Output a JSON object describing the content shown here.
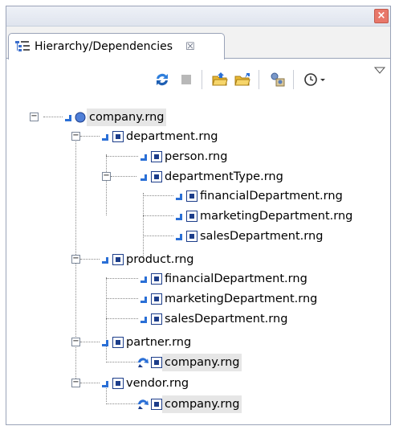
{
  "window": {
    "close_glyph": "×"
  },
  "view": {
    "tab_title": "Hierarchy/Dependencies",
    "tab_close_glyph": "☒"
  },
  "toolbar": {
    "icons": [
      "refresh-icon",
      "stop-icon",
      "open-folder-icon",
      "open-folder-icon",
      "configure-icon",
      "history-dropdown-icon",
      "view-menu-icon"
    ]
  },
  "tree": {
    "nodes": [
      {
        "label": "company.rng",
        "depth": 0,
        "kind": "root"
      },
      {
        "label": "department.rng",
        "depth": 1,
        "kind": "include"
      },
      {
        "label": "person.rng",
        "depth": 2,
        "kind": "include"
      },
      {
        "label": "departmentType.rng",
        "depth": 2,
        "kind": "include"
      },
      {
        "label": "financialDepartment.rng",
        "depth": 3,
        "kind": "include"
      },
      {
        "label": "marketingDepartment.rng",
        "depth": 3,
        "kind": "include"
      },
      {
        "label": "salesDepartment.rng",
        "depth": 3,
        "kind": "include"
      },
      {
        "label": "product.rng",
        "depth": 1,
        "kind": "include"
      },
      {
        "label": "financialDepartment.rng",
        "depth": 2,
        "kind": "include"
      },
      {
        "label": "marketingDepartment.rng",
        "depth": 2,
        "kind": "include"
      },
      {
        "label": "salesDepartment.rng",
        "depth": 2,
        "kind": "include"
      },
      {
        "label": "partner.rng",
        "depth": 1,
        "kind": "include"
      },
      {
        "label": "company.rng",
        "depth": 2,
        "kind": "recursive"
      },
      {
        "label": "vendor.rng",
        "depth": 1,
        "kind": "include"
      },
      {
        "label": "company.rng",
        "depth": 2,
        "kind": "recursive"
      }
    ]
  },
  "colors": {
    "arrow": "#2a6fd6",
    "box": "#1c3d8a",
    "highlight": "#e6e6e6"
  }
}
